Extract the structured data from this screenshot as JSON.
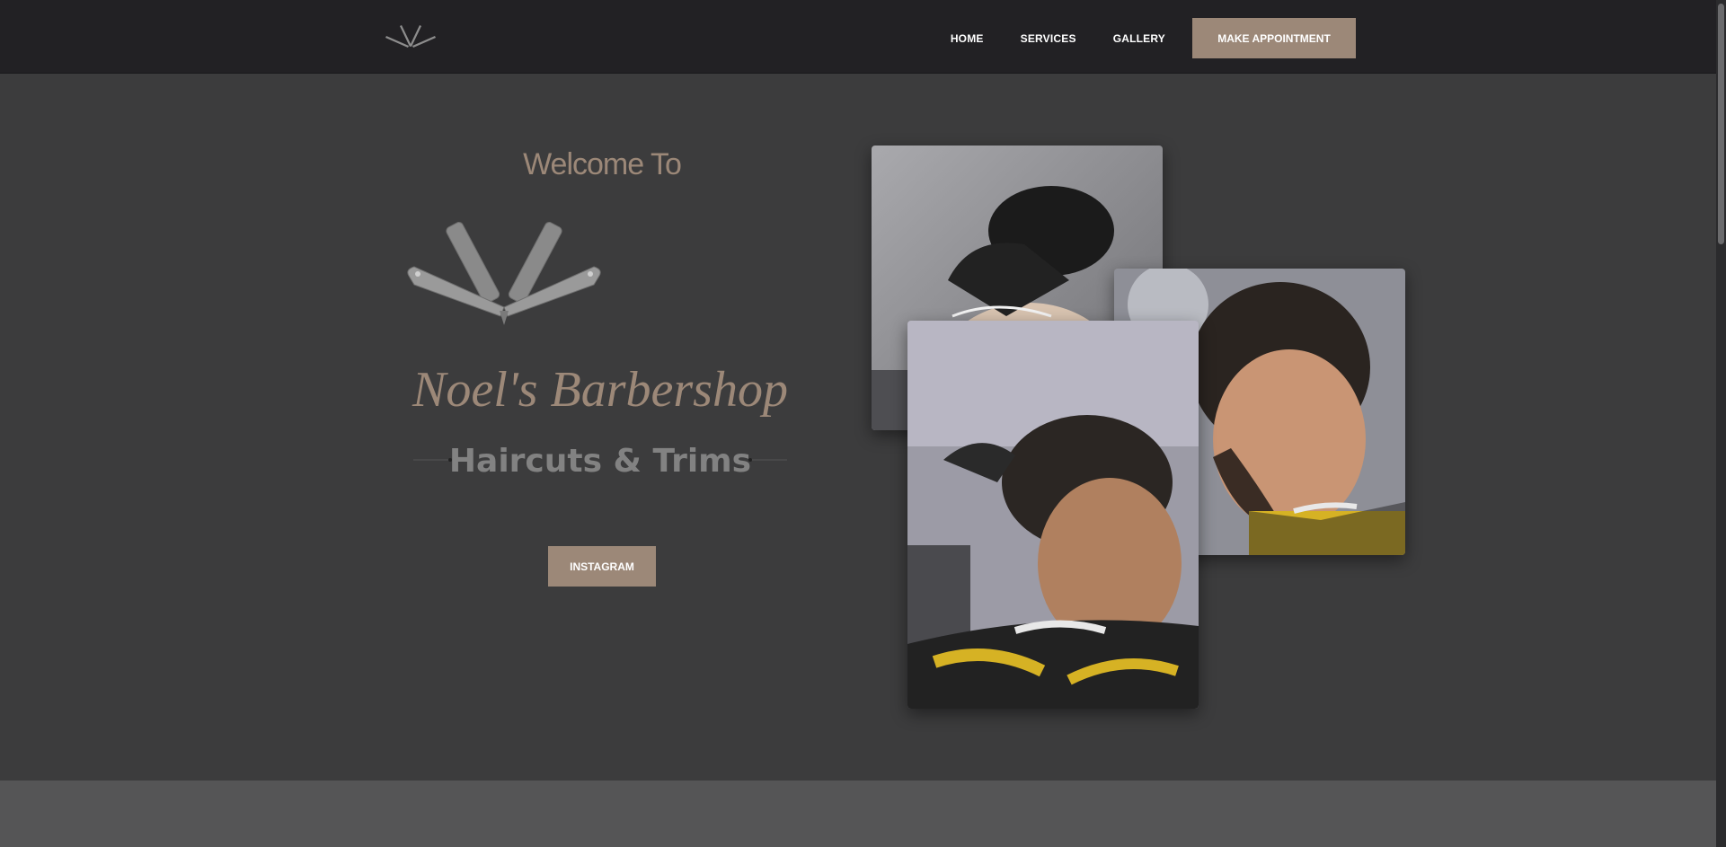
{
  "nav": {
    "logo_icon": "crossed-razors-icon",
    "links": [
      "HOME",
      "SERVICES",
      "GALLERY"
    ],
    "appointment_label": "MAKE APPOINTMENT"
  },
  "hero": {
    "welcome": "Welcome To",
    "brand": "Noel's Barbershop",
    "tagline": "Haircuts & Trims",
    "instagram_label": "INSTAGRAM"
  },
  "colors": {
    "accent": "#9c8878",
    "nav_bg": "#222124",
    "hero_bg": "#3c3c3d"
  }
}
